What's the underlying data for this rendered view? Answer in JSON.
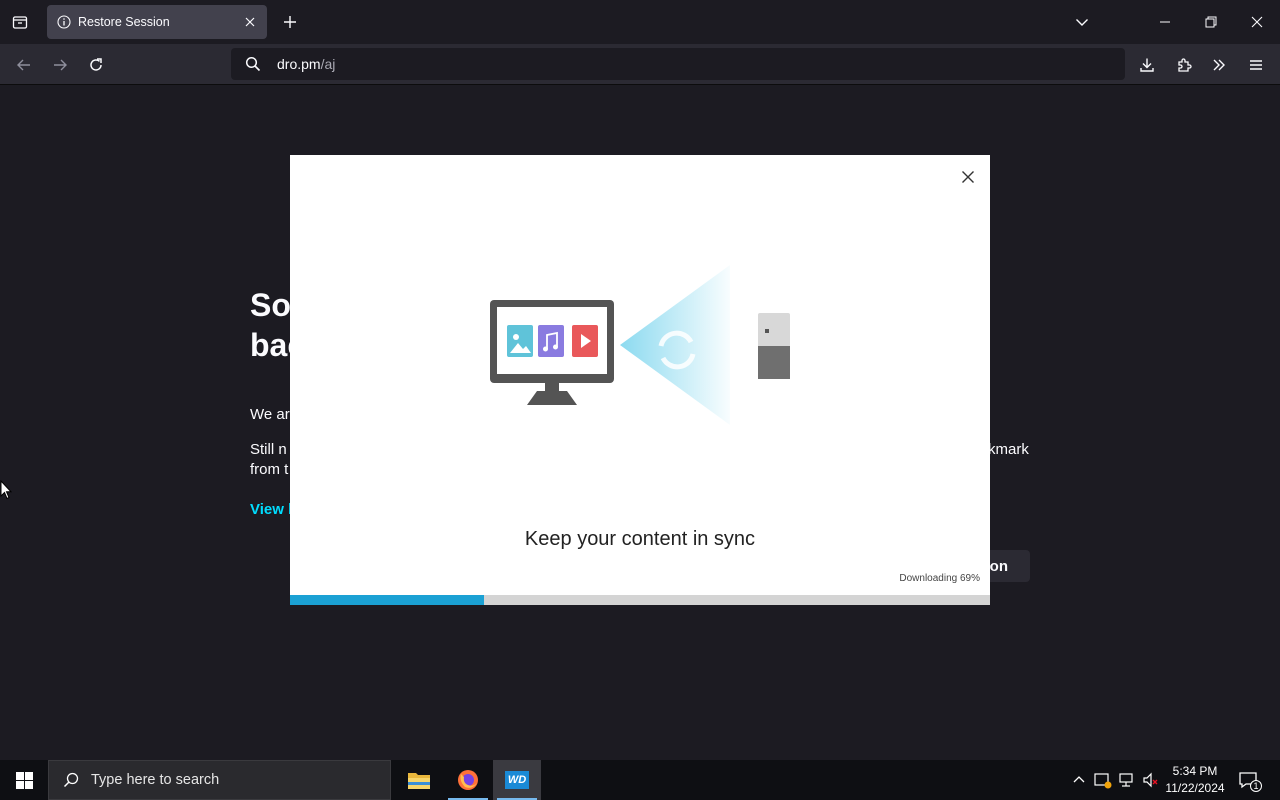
{
  "browser": {
    "tab": {
      "title": "Restore Session"
    },
    "url": {
      "host": "dro.pm",
      "path": "/aj"
    }
  },
  "page": {
    "title_line1": "So",
    "title_line2": "bac",
    "para1": "We ar",
    "para2_line1": "Still n",
    "para2_right": "kmark",
    "para2_line2": "from t",
    "link": "View l",
    "button_fragment": "on"
  },
  "dialog": {
    "caption": "Keep your content in sync",
    "status": "Downloading 69%",
    "progress_fraction": 0.277,
    "colors": {
      "accent": "#1ba1d4",
      "image_tile": "#5fc3d9",
      "music_tile": "#8a7be0",
      "video_tile": "#e9585a"
    }
  },
  "taskbar": {
    "search_placeholder": "Type here to search",
    "time": "5:34 PM",
    "date": "11/22/2024",
    "notification_count": "1",
    "apps": [
      "file-explorer-icon",
      "firefox-icon",
      "wd-icon"
    ],
    "wd_label": "WD"
  }
}
